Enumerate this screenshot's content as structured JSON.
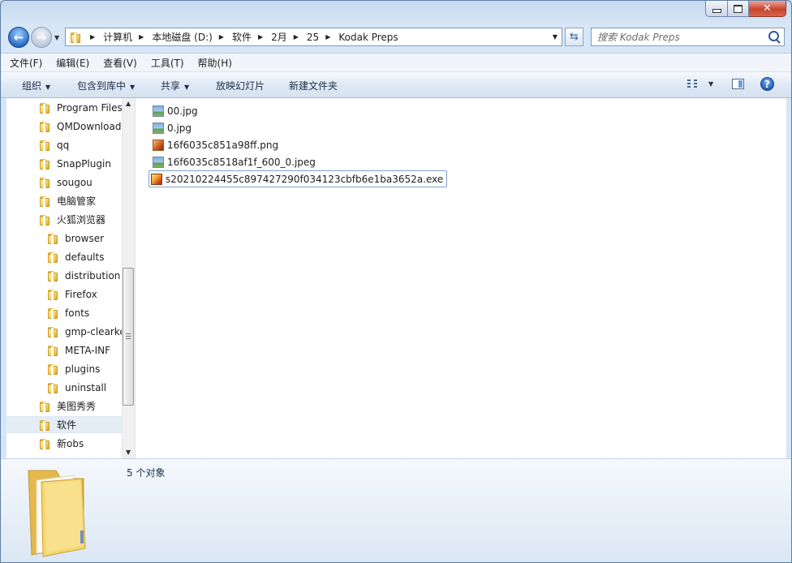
{
  "breadcrumb": [
    "计算机",
    "本地磁盘 (D:)",
    "软件",
    "2月",
    "25",
    "Kodak Preps"
  ],
  "search": {
    "placeholder": "搜索 Kodak Preps"
  },
  "menu": [
    "文件(F)",
    "编辑(E)",
    "查看(V)",
    "工具(T)",
    "帮助(H)"
  ],
  "toolbar": {
    "organize": "组织",
    "include_library": "包含到库中",
    "share": "共享",
    "slideshow": "放映幻灯片",
    "new_folder": "新建文件夹"
  },
  "nav_tree": [
    {
      "label": "Program Files",
      "level": 1
    },
    {
      "label": "QMDownload",
      "level": 1
    },
    {
      "label": "qq",
      "level": 1
    },
    {
      "label": "SnapPlugin",
      "level": 1
    },
    {
      "label": "sougou",
      "level": 1
    },
    {
      "label": "电脑管家",
      "level": 1
    },
    {
      "label": "火狐浏览器",
      "level": 1
    },
    {
      "label": "browser",
      "level": 2
    },
    {
      "label": "defaults",
      "level": 2
    },
    {
      "label": "distribution",
      "level": 2
    },
    {
      "label": "Firefox",
      "level": 2
    },
    {
      "label": "fonts",
      "level": 2
    },
    {
      "label": "gmp-clearke",
      "level": 2
    },
    {
      "label": "META-INF",
      "level": 2
    },
    {
      "label": "plugins",
      "level": 2
    },
    {
      "label": "uninstall",
      "level": 2
    },
    {
      "label": "美图秀秀",
      "level": 1
    },
    {
      "label": "软件",
      "level": 1,
      "selected": true
    },
    {
      "label": "新obs",
      "level": 1
    }
  ],
  "files": [
    {
      "name": "00.jpg",
      "icon": "jpg-image-icon"
    },
    {
      "name": "0.jpg",
      "icon": "jpg-image-icon"
    },
    {
      "name": "16f6035c851a98ff.png",
      "icon": "png-image-icon"
    },
    {
      "name": "16f6035c8518af1f_600_0.jpeg",
      "icon": "jpg-image-icon"
    },
    {
      "name": "s20210224455c897427290f034123cbfb6e1ba3652a.exe",
      "icon": "exe-app-icon",
      "selected": true
    }
  ],
  "details": {
    "count": "5 个对象"
  },
  "colors": {
    "accent": "#2b6cc4",
    "selection": "#e5edf6",
    "selection_border": "#7da2ce"
  }
}
